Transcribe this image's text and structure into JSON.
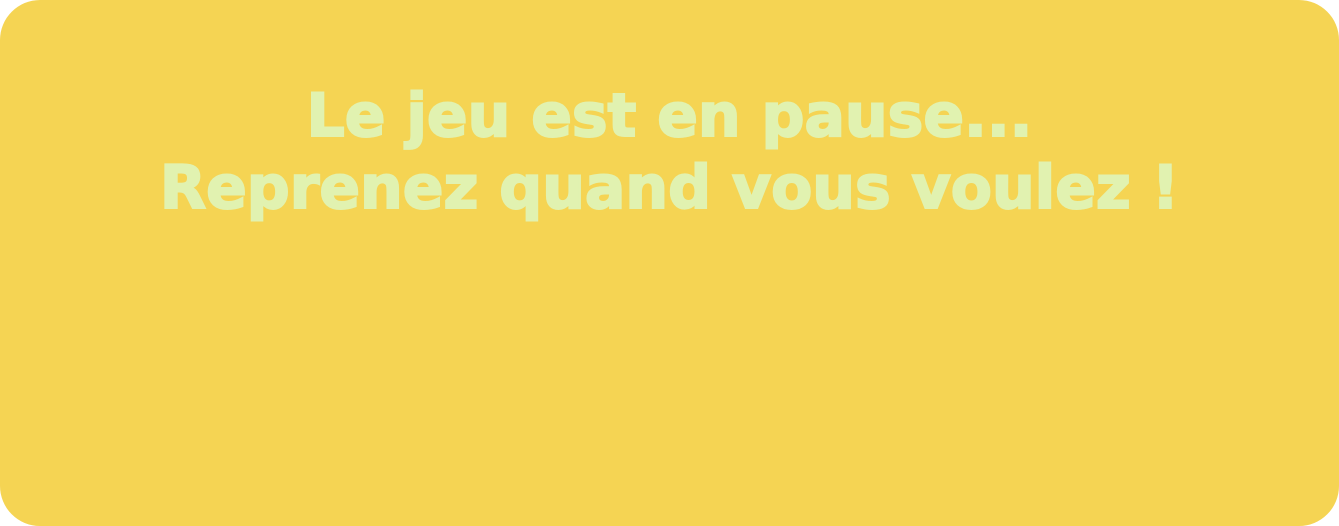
{
  "pause_screen": {
    "line1": "Le jeu est en pause...",
    "line2": "Reprenez quand vous voulez !"
  },
  "colors": {
    "panel_background": "#f5d453",
    "text": "#e1f2b0"
  }
}
